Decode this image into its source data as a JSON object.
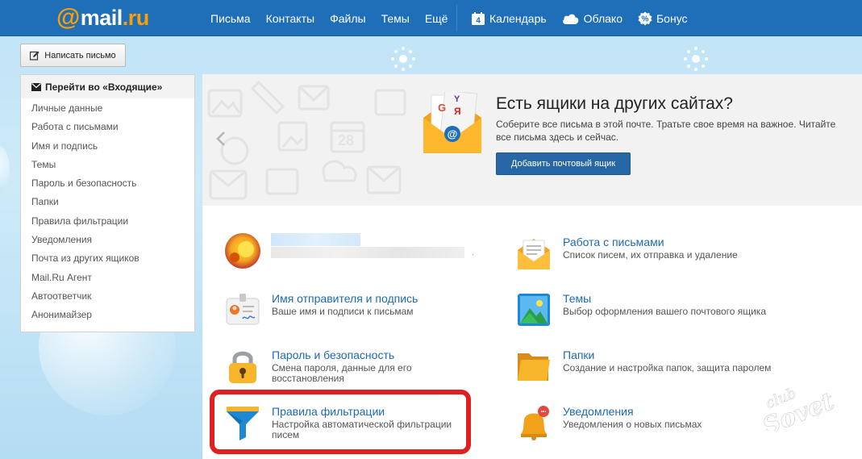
{
  "header": {
    "logo": {
      "at": "@",
      "mail": "mail",
      "ru": ".ru"
    },
    "nav": [
      "Письма",
      "Контакты",
      "Файлы",
      "Темы",
      "Ещё"
    ],
    "services": [
      {
        "label": "Календарь",
        "icon": "calendar-icon",
        "day": "4"
      },
      {
        "label": "Облако",
        "icon": "cloud-icon"
      },
      {
        "label": "Бонус",
        "icon": "bonus-icon"
      }
    ]
  },
  "compose": {
    "label": "Написать письмо",
    "icon": "pencil-icon"
  },
  "sidebar": {
    "inbox_label": "Перейти во «Входящие»",
    "items": [
      "Личные данные",
      "Работа с письмами",
      "Имя и подпись",
      "Темы",
      "Пароль и безопасность",
      "Папки",
      "Правила фильтрации",
      "Уведомления",
      "Почта из других ящиков",
      "Mail.Ru Агент",
      "Автоответчик",
      "Анонимайзер"
    ]
  },
  "promo": {
    "title": "Есть ящики на других сайтах?",
    "text": "Соберите все письма в этой почте. Тратьте свое время на важное. Читайте все письма здесь и сейчас.",
    "button": "Добавить почтовый ящик",
    "calendar_day": "28"
  },
  "tiles": {
    "mail_work": {
      "title": "Работа с письмами",
      "desc": "Список писем, их отправка и удаление"
    },
    "sender": {
      "title": "Имя отправителя и подпись",
      "desc": "Ваше имя и подписи к письмам"
    },
    "themes": {
      "title": "Темы",
      "desc": "Выбор оформления вашего почтового ящика"
    },
    "password": {
      "title": "Пароль и безопасность",
      "desc": "Смена пароля, данные для его восстановления"
    },
    "folders": {
      "title": "Папки",
      "desc": "Создание и настройка папок, защита паролем"
    },
    "filters": {
      "title": "Правила фильтрации",
      "desc": "Настройка автоматической фильтрации писем"
    },
    "notifications": {
      "title": "Уведомления",
      "desc": "Уведомления о новых письмах"
    }
  },
  "profile_blur_dot": ".",
  "colors": {
    "header_bg": "#1e6fb8",
    "accent_orange": "#ff9e00",
    "link_blue": "#1d6ab2",
    "button_blue": "#2767a5",
    "highlight_red": "#e02020"
  }
}
